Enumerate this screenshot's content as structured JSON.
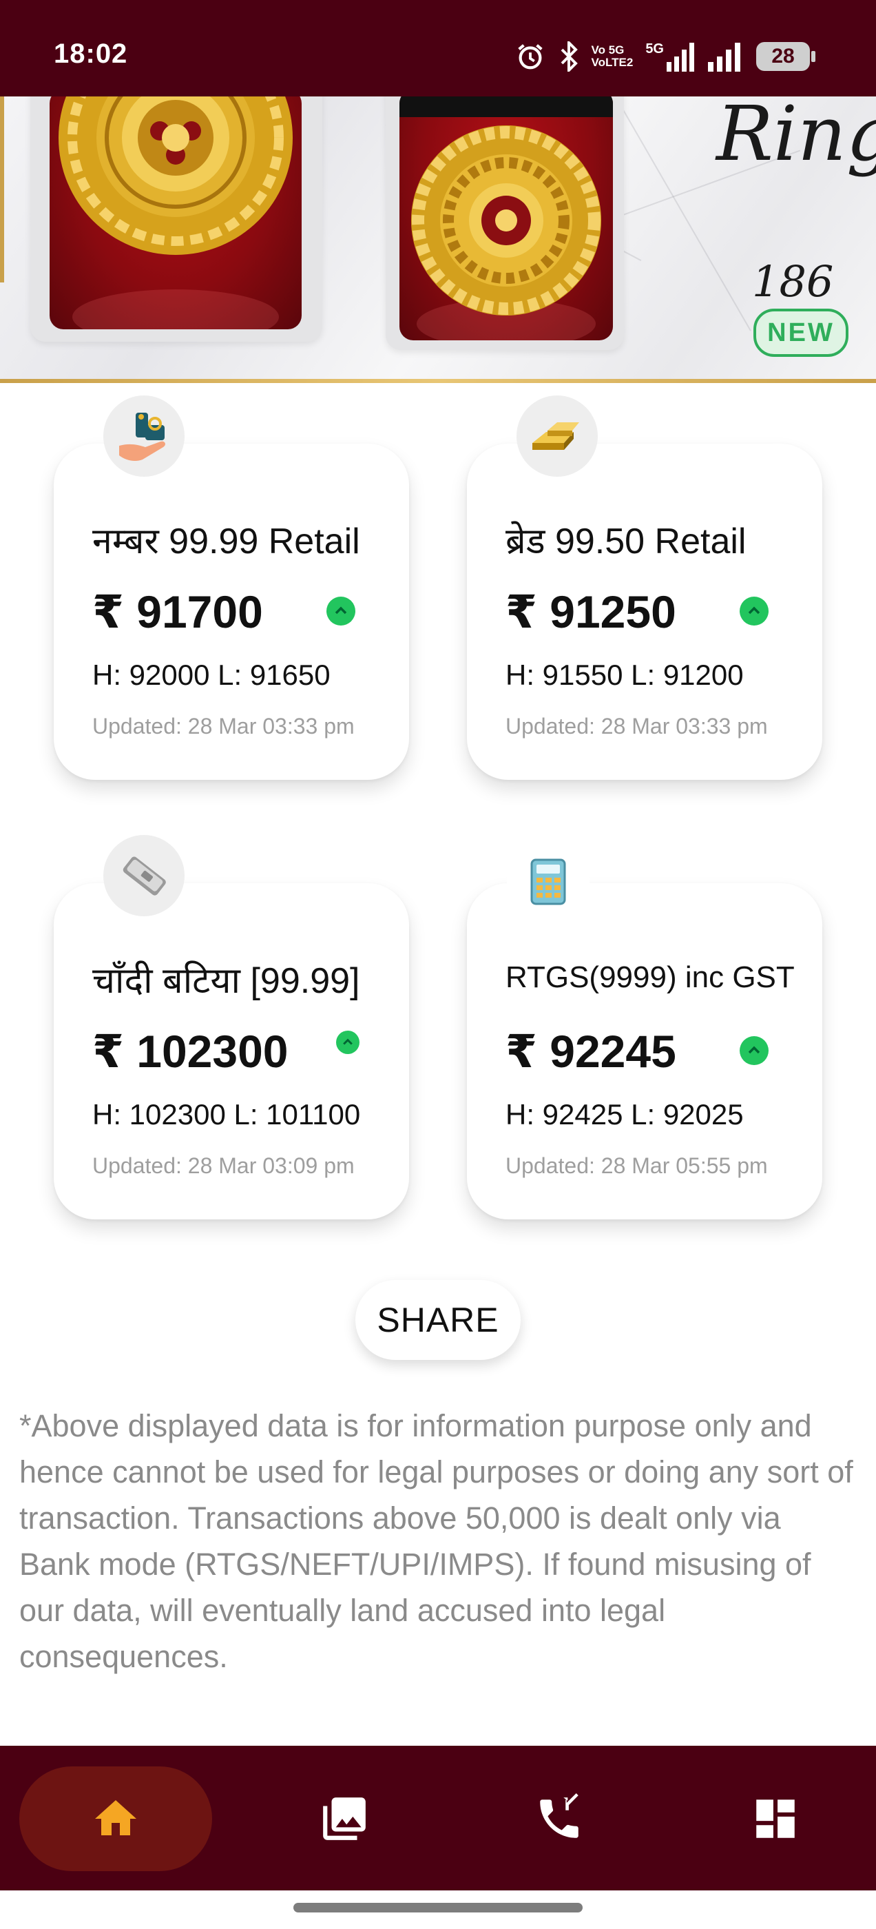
{
  "status_bar": {
    "time": "18:02",
    "network_label_1": "Vo 5G",
    "network_label_2": "VoLTE2",
    "network_type": "5G",
    "battery": "28",
    "icons": [
      "alarm-icon",
      "bluetooth-icon",
      "volte-icon",
      "signal-icon",
      "signal-icon",
      "battery-icon"
    ]
  },
  "banner": {
    "script_title_fragment": "Ring",
    "script_number_fragment": "186",
    "badge": "NEW",
    "colors": {
      "badge": "#2fae5b",
      "frame_gold": "#c9a04a"
    }
  },
  "rates": [
    {
      "icon": "jewellery-hand-icon",
      "title": "नम्बर 99.99 Retail",
      "price": "₹ 91700",
      "trend": "up",
      "high_low": "H: 92000  L: 91650",
      "updated": "Updated: 28 Mar 03:33 pm"
    },
    {
      "icon": "gold-bars-icon",
      "title": "ब्रेड 99.50 Retail",
      "price": "₹ 91250",
      "trend": "up",
      "high_low": "H: 91550  L: 91200",
      "updated": "Updated: 28 Mar 03:33 pm"
    },
    {
      "icon": "silver-bar-icon",
      "title": "चाँदी बटिया [99.99]",
      "price": "₹ 102300",
      "trend": "up",
      "high_low": "H: 102300  L: 101100",
      "updated": "Updated: 28 Mar 03:09 pm"
    },
    {
      "icon": "calculator-icon",
      "title": "RTGS(9999) inc GST",
      "price": "₹ 92245",
      "trend": "up",
      "high_low": "H: 92425  L: 92025",
      "updated": "Updated: 28 Mar 05:55 pm"
    }
  ],
  "share_label": "SHARE",
  "disclaimer": "*Above displayed data is for information purpose only and hence cannot be used for legal purposes or doing any sort of transaction. Transactions above 50,000 is dealt only via Bank mode (RTGS/NEFT/UPI/IMPS). If found misusing of our data, will eventually land accused into legal consequences.",
  "bottom_nav": {
    "items": [
      "home-icon",
      "gallery-icon",
      "contact-call-icon",
      "dashboard-icon"
    ],
    "active": "home-icon"
  },
  "colors": {
    "primary": "#4b0012",
    "nav_active_bg": "#6d1412",
    "nav_active_icon": "#f5a623",
    "trend_up": "#22c55e",
    "muted_text": "#9e9e9e"
  }
}
